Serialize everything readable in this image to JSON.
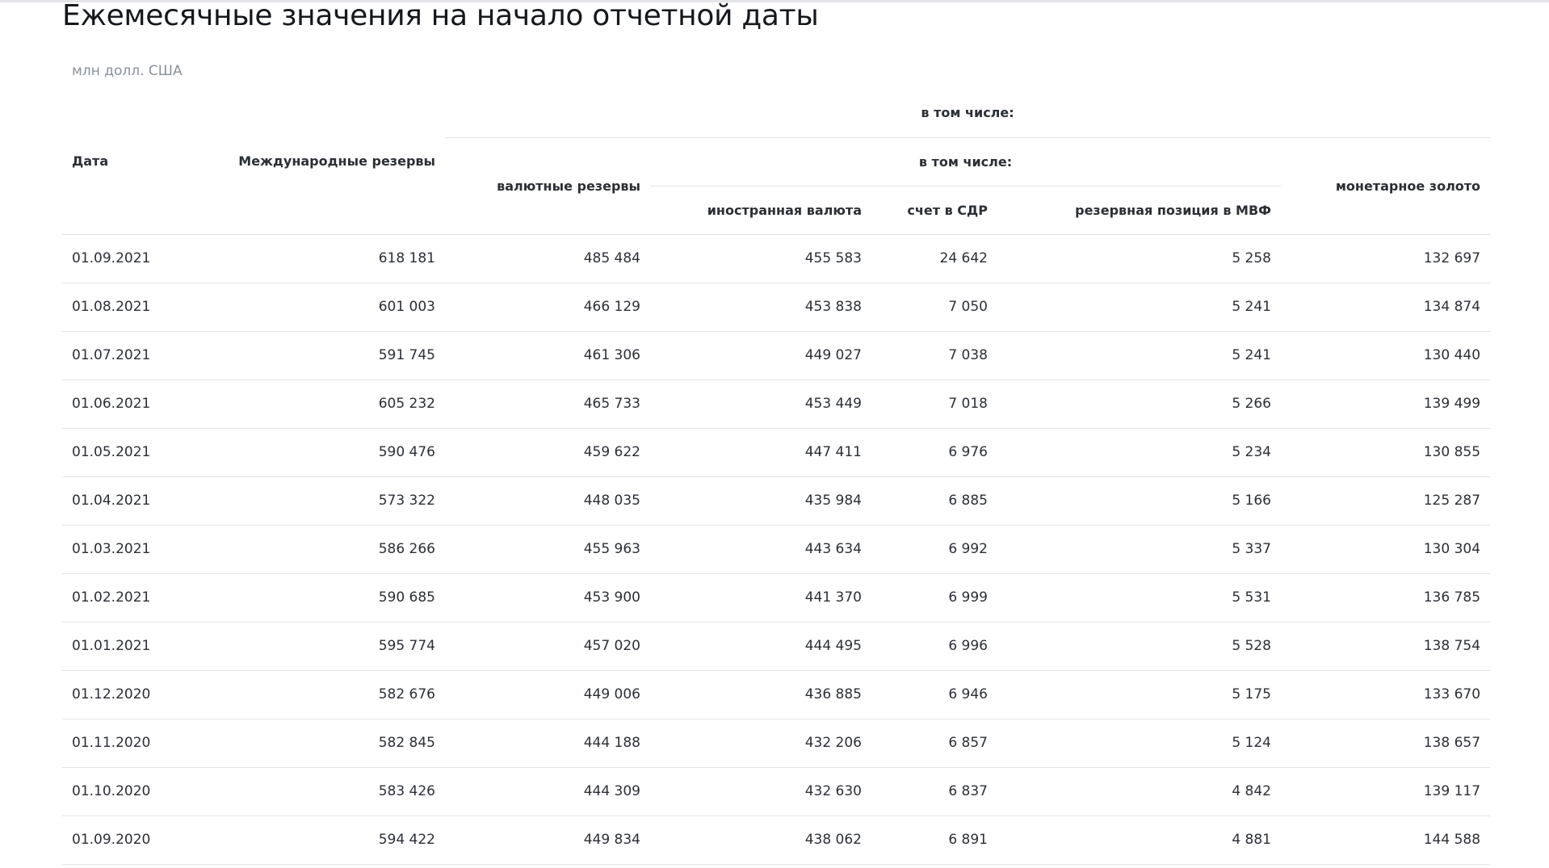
{
  "header": {
    "title": "Ежемесячные значения на начало отчетной даты",
    "units": "млн долл. США"
  },
  "table": {
    "headers": {
      "date": "Дата",
      "international_reserves": "Международные резервы",
      "including_1": "в том числе:",
      "currency_reserves": "валютные резервы",
      "including_2": "в том числе:",
      "foreign_currency": "иностранная валюта",
      "sdr_account": "счет в СДР",
      "imf_position": "резервная позиция в МВФ",
      "monetary_gold": "монетарное золото"
    },
    "rows": [
      {
        "date": "01.09.2021",
        "intl": "618 181",
        "currency": "485 484",
        "foreign": "455 583",
        "sdr": "24 642",
        "imf": "5 258",
        "gold": "132 697"
      },
      {
        "date": "01.08.2021",
        "intl": "601 003",
        "currency": "466 129",
        "foreign": "453 838",
        "sdr": "7 050",
        "imf": "5 241",
        "gold": "134 874"
      },
      {
        "date": "01.07.2021",
        "intl": "591 745",
        "currency": "461 306",
        "foreign": "449 027",
        "sdr": "7 038",
        "imf": "5 241",
        "gold": "130 440"
      },
      {
        "date": "01.06.2021",
        "intl": "605 232",
        "currency": "465 733",
        "foreign": "453 449",
        "sdr": "7 018",
        "imf": "5 266",
        "gold": "139 499"
      },
      {
        "date": "01.05.2021",
        "intl": "590 476",
        "currency": "459 622",
        "foreign": "447 411",
        "sdr": "6 976",
        "imf": "5 234",
        "gold": "130 855"
      },
      {
        "date": "01.04.2021",
        "intl": "573 322",
        "currency": "448 035",
        "foreign": "435 984",
        "sdr": "6 885",
        "imf": "5 166",
        "gold": "125 287"
      },
      {
        "date": "01.03.2021",
        "intl": "586 266",
        "currency": "455 963",
        "foreign": "443 634",
        "sdr": "6 992",
        "imf": "5 337",
        "gold": "130 304"
      },
      {
        "date": "01.02.2021",
        "intl": "590 685",
        "currency": "453 900",
        "foreign": "441 370",
        "sdr": "6 999",
        "imf": "5 531",
        "gold": "136 785"
      },
      {
        "date": "01.01.2021",
        "intl": "595 774",
        "currency": "457 020",
        "foreign": "444 495",
        "sdr": "6 996",
        "imf": "5 528",
        "gold": "138 754"
      },
      {
        "date": "01.12.2020",
        "intl": "582 676",
        "currency": "449 006",
        "foreign": "436 885",
        "sdr": "6 946",
        "imf": "5 175",
        "gold": "133 670"
      },
      {
        "date": "01.11.2020",
        "intl": "582 845",
        "currency": "444 188",
        "foreign": "432 206",
        "sdr": "6 857",
        "imf": "5 124",
        "gold": "138 657"
      },
      {
        "date": "01.10.2020",
        "intl": "583 426",
        "currency": "444 309",
        "foreign": "432 630",
        "sdr": "6 837",
        "imf": "4 842",
        "gold": "139 117"
      },
      {
        "date": "01.09.2020",
        "intl": "594 422",
        "currency": "449 834",
        "foreign": "438 062",
        "sdr": "6 891",
        "imf": "4 881",
        "gold": "144 588"
      }
    ]
  }
}
